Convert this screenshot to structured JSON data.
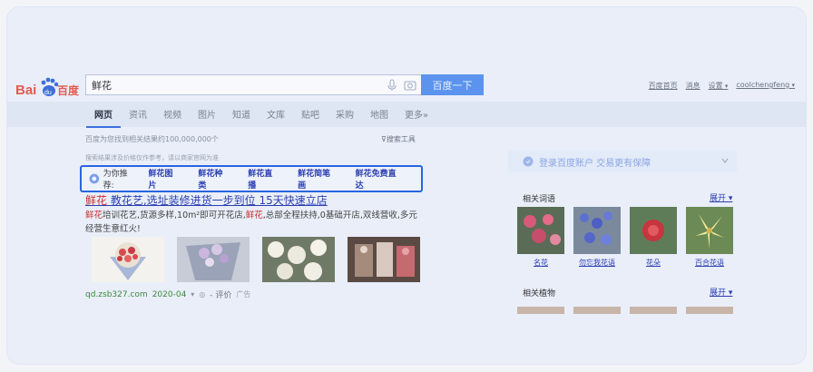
{
  "logo": {
    "text_bai": "Bai",
    "text_du": "du",
    "text_cn": "百度"
  },
  "search": {
    "value": "鲜花",
    "button_label": "百度一下"
  },
  "top_links": [
    "百度首页",
    "消息",
    "设置",
    "coolchengfeng"
  ],
  "nav": {
    "tabs": [
      "网页",
      "资讯",
      "视频",
      "图片",
      "知道",
      "文库",
      "贴吧",
      "采购",
      "地图",
      "更多»"
    ]
  },
  "results": {
    "count_text": "百度为您找到相关结果约100,000,000个",
    "tools_label": "搜索工具",
    "notice": "搜索结果涉及价格仅作参考，请以商家官网为准"
  },
  "recommend": {
    "label": "为你推荐:",
    "links": [
      "鲜花图片",
      "鲜花种类",
      "鲜花直播",
      "鲜花简笔画",
      "鲜花免费直达"
    ]
  },
  "ad": {
    "title_hl": "鲜花",
    "title_rest": " 教花艺,选址装修进货一步到位 15天快速立店",
    "desc_hl1": "鲜花",
    "desc_part1": "培训花艺,货源多样,10m²即可开花店,",
    "desc_hl2": "鲜花",
    "desc_part2": ",总部全程扶持,0基础开店,双线营收,多元经营生意红火!",
    "url": "qd.zsb327.com",
    "date": "2020-04",
    "eval": "- 评价",
    "tag": "广告"
  },
  "right": {
    "login_text": "登录百度账户  交易更有保障",
    "related_words_title": "相关词语",
    "expand_label": "展开",
    "words": [
      "名花",
      "勿忘我花语",
      "花朵",
      "百合花语"
    ],
    "related_plants_title": "相关植物"
  },
  "colors": {
    "accent": "#5b93ee",
    "link": "#2b3fb2",
    "highlight": "#c8322f",
    "url_green": "#3b8a3b",
    "box_border": "#2a64e0"
  }
}
